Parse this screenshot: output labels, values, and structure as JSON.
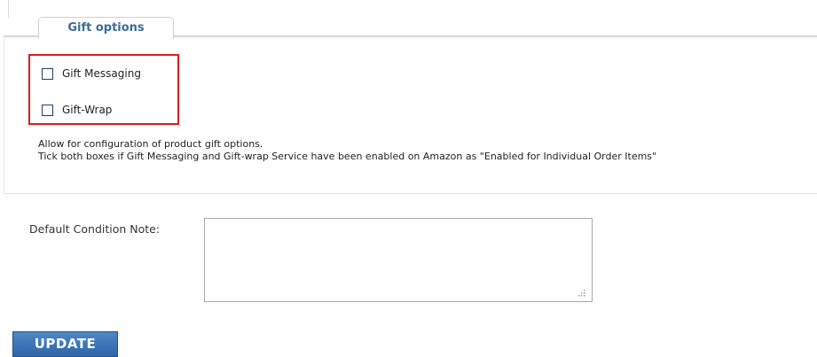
{
  "gift_options": {
    "legend": "Gift options",
    "options": [
      {
        "label": "Gift Messaging",
        "checked": false
      },
      {
        "label": "Gift-Wrap",
        "checked": false
      }
    ],
    "description_line1": "Allow for configuration of product gift options.",
    "description_line2": "Tick both boxes if Gift Messaging and Gift-wrap Service have been enabled on Amazon as \"Enabled for Individual Order Items\""
  },
  "condition_note": {
    "label": "Default Condition Note:",
    "value": ""
  },
  "actions": {
    "update_label": "UPDATE"
  },
  "colors": {
    "legend_text": "#3b6d96",
    "highlight_border": "#e01b1b",
    "button_bg": "#2d65a8"
  }
}
